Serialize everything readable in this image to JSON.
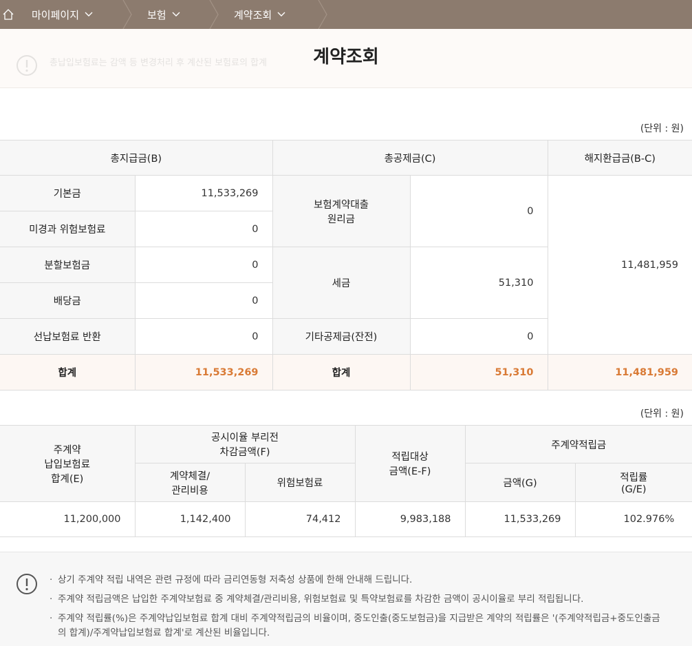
{
  "nav": {
    "home_icon": "home-icon",
    "crumbs": [
      "마이페이지",
      "보험",
      "계약조회"
    ]
  },
  "notice_bar": {
    "ghost_text": "총납입보험료는 감액 등 변경처리 후 계산된 보험료의 합계",
    "title": "계약조회"
  },
  "unit_label": "(단위 : 원)",
  "table1": {
    "headers": {
      "total_payment": "총지급금(B)",
      "total_deduction": "총공제금(C)",
      "refund": "해지환급금(B-C)"
    },
    "rows": [
      {
        "label": "기본금",
        "value": "11,533,269"
      },
      {
        "label": "미경과 위험보험료",
        "value": "0"
      },
      {
        "label": "분할보험금",
        "value": "0"
      },
      {
        "label": "배당금",
        "value": "0"
      },
      {
        "label": "선납보험료 반환",
        "value": "0"
      }
    ],
    "deductions": [
      {
        "label_line1": "보험계약대출",
        "label_line2": "원리금",
        "value": "0"
      },
      {
        "label": "세금",
        "value": "51,310"
      },
      {
        "label": "기타공제금(잔전)",
        "value": "0"
      }
    ],
    "refund_value": "11,481,959",
    "sum": {
      "label": "합계",
      "payment": "11,533,269",
      "deduction": "51,310",
      "refund": "11,481,959"
    }
  },
  "table2": {
    "col_e": [
      "주계약",
      "납입보험료",
      "합계(E)"
    ],
    "col_f": [
      "공시이율 부리전",
      "차감금액(F)"
    ],
    "col_f1": [
      "계약체결/",
      "관리비용"
    ],
    "col_f2": "위험보험료",
    "col_ef": [
      "적립대상",
      "금액(E-F)"
    ],
    "col_g_group": "주계약적립금",
    "col_g": "금액(G)",
    "col_rate": [
      "적립률",
      "(G/E)"
    ],
    "row": {
      "e": "11,200,000",
      "f1": "1,142,400",
      "f2": "74,412",
      "ef": "9,983,188",
      "g": "11,533,269",
      "rate": "102.976%"
    }
  },
  "notes": [
    "상기 주계약 적립 내역은 관련 규정에 따라 금리연동형 저축성 상품에 한해 안내해 드립니다.",
    "주계약 적립금액은 납입한 주계약보험료 중 계약체결/관리비용, 위험보험료 및 특약보험료를 차감한 금액이 공시이율로 부리 적립됩니다.",
    "주계약 적립률(%)은 주계약납입보험료 합계 대비 주계약적립금의 비율이며, 중도인출(중도보험금)을 지급받은 계약의 적립률은 '(주계약적립금+중도인출금의 합계)/주계약납입보험료 합계'로 계산된 비율입니다."
  ],
  "colors": {
    "nav_bg": "#8c7b6e",
    "accent_orange": "#d97a35",
    "header_bg": "#f7f7f7",
    "sum_bg": "#fdf7f3"
  }
}
